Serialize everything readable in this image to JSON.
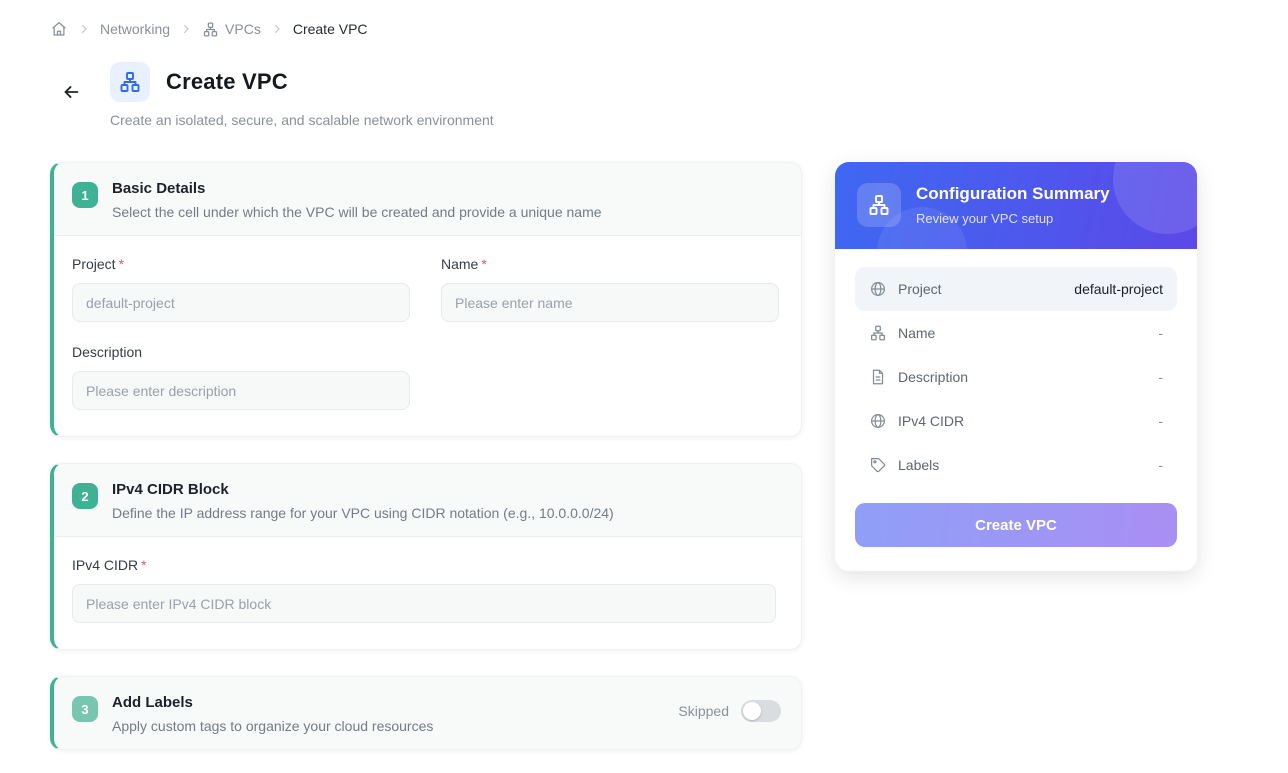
{
  "breadcrumb": {
    "networking": "Networking",
    "vpcs": "VPCs",
    "current": "Create VPC"
  },
  "header": {
    "title": "Create VPC",
    "subtitle": "Create an isolated, secure, and scalable network environment"
  },
  "sections": {
    "basic": {
      "step": "1",
      "title": "Basic Details",
      "description": "Select the cell under which the VPC will be created and provide a unique name",
      "fields": {
        "project": {
          "label": "Project",
          "required": "*",
          "value": "default-project"
        },
        "name": {
          "label": "Name",
          "required": "*",
          "placeholder": "Please enter name"
        },
        "description": {
          "label": "Description",
          "placeholder": "Please enter description"
        }
      }
    },
    "cidr": {
      "step": "2",
      "title": "IPv4 CIDR Block",
      "description": "Define the IP address range for your VPC using CIDR notation (e.g., 10.0.0.0/24)",
      "fields": {
        "ipv4": {
          "label": "IPv4 CIDR",
          "required": "*",
          "placeholder": "Please enter IPv4 CIDR block"
        }
      }
    },
    "labels": {
      "step": "3",
      "title": "Add Labels",
      "description": "Apply custom tags to organize your cloud resources",
      "skipped_label": "Skipped",
      "toggle_state": "off"
    }
  },
  "summary": {
    "title": "Configuration Summary",
    "subtitle": "Review your VPC setup",
    "rows": [
      {
        "icon": "globe-icon",
        "label": "Project",
        "value": "default-project"
      },
      {
        "icon": "network-icon",
        "label": "Name",
        "value": "-"
      },
      {
        "icon": "document-icon",
        "label": "Description",
        "value": "-"
      },
      {
        "icon": "globe-icon",
        "label": "IPv4 CIDR",
        "value": "-"
      },
      {
        "icon": "tag-icon",
        "label": "Labels",
        "value": "-"
      }
    ],
    "button_label": "Create VPC",
    "button_state": "disabled"
  },
  "colors": {
    "accent_green": "#3fb295",
    "accent_green_muted": "#79c6b0",
    "header_gradient_start": "#3e68f2",
    "header_gradient_end": "#5b49e8",
    "button_gradient_start": "#8f9ff8",
    "button_gradient_end": "#a98ff2",
    "required_red": "#e0566a",
    "header_icon_blue": "#2b6cf0"
  }
}
